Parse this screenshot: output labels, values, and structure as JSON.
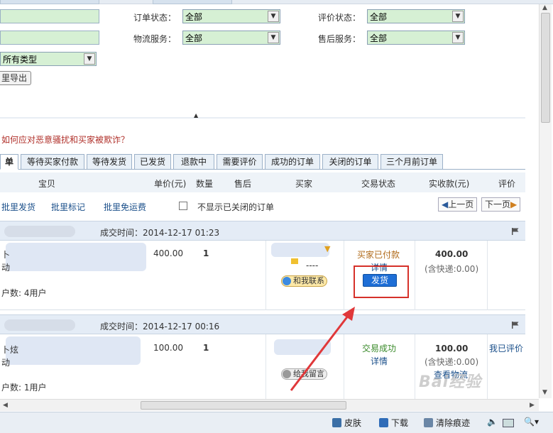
{
  "filters": {
    "order_status_label": "订单状态：",
    "order_status_value": "全部",
    "review_status_label": "评价状态：",
    "review_status_value": "全部",
    "logistics_label": "物流服务：",
    "logistics_value": "全部",
    "aftersale_label": "售后服务：",
    "aftersale_value": "全部",
    "type_value": "所有类型",
    "export_label": "里导出"
  },
  "warning_link": "如何应对恶意骚扰和买家被欺诈？",
  "tabs": [
    "单",
    "等待买家付款",
    "等待发货",
    "已发货",
    "退款中",
    "需要评价",
    "成功的订单",
    "关闭的订单",
    "三个月前订单"
  ],
  "columns": [
    "宝贝",
    "单价(元)",
    "数量",
    "售后",
    "买家",
    "交易状态",
    "实收款(元)",
    "评价"
  ],
  "toolbar": {
    "batch_ship": "批里发货",
    "batch_mark": "批里标记",
    "batch_free_ship": "批里免运费",
    "hide_closed": "不显示已关闭的订单",
    "prev": "上一页",
    "next": "下一页"
  },
  "orders": [
    {
      "time_label": "成交时间：",
      "time": "2014-12-17 01:23",
      "item_frag1": "卜",
      "item_frag2": "动",
      "users": "户数: 4用户",
      "price": "400.00",
      "qty": "1",
      "buyer_tail": "----",
      "contact": "和我联系",
      "status": "买家已付款",
      "detail": "详情",
      "ship_btn": "发货",
      "amount": "400.00",
      "shipping": "(含快递:0.00)",
      "review": ""
    },
    {
      "time_label": "成交时间：",
      "time": "2014-12-17 00:16",
      "item_frag1": "卜炫",
      "item_frag2": "动",
      "users": "户数: 1用户",
      "price": "100.00",
      "qty": "1",
      "buyer_tail": "",
      "contact": "给我留言",
      "status": "交易成功",
      "detail": "详情",
      "amount": "100.00",
      "shipping": "(含快递:0.00)",
      "logistics": "查看物流",
      "review": "我已评价"
    }
  ],
  "statusbar": {
    "skin": "皮肤",
    "download": "下载",
    "clear": "清除痕迹"
  },
  "watermark": "Bai经验",
  "colors": {
    "accent": "#1e6ed6",
    "highlight_box": "#d6312a",
    "status_paid": "#b06a1a",
    "status_success": "#3a8a2a"
  }
}
